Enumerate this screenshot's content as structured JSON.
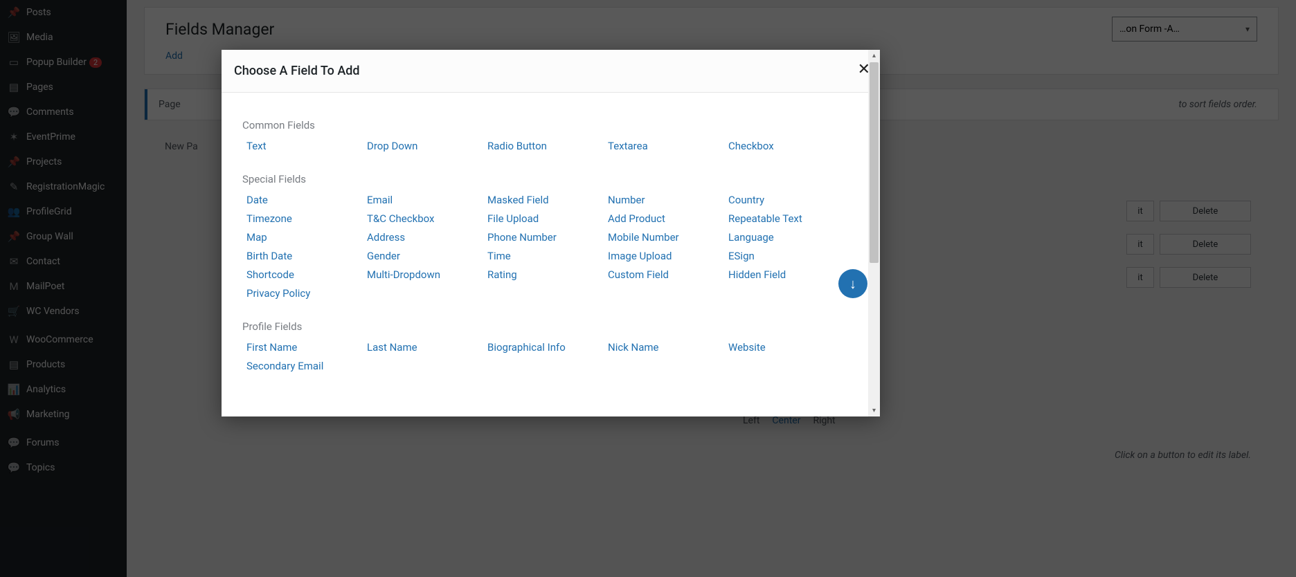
{
  "sidebar": {
    "items": [
      {
        "icon": "📌",
        "label": "Posts"
      },
      {
        "icon": "🖼",
        "label": "Media"
      },
      {
        "icon": "▭",
        "label": "Popup Builder",
        "badge": "2"
      },
      {
        "icon": "▤",
        "label": "Pages"
      },
      {
        "icon": "💬",
        "label": "Comments"
      },
      {
        "icon": "✶",
        "label": "EventPrime"
      },
      {
        "icon": "📌",
        "label": "Projects"
      },
      {
        "icon": "✎",
        "label": "RegistrationMagic"
      },
      {
        "icon": "👥",
        "label": "ProfileGrid"
      },
      {
        "icon": "📌",
        "label": "Group Wall"
      },
      {
        "icon": "✉",
        "label": "Contact"
      },
      {
        "icon": "M",
        "label": "MailPoet"
      },
      {
        "icon": "🛒",
        "label": "WC Vendors"
      },
      {
        "icon": "",
        "label": ""
      },
      {
        "icon": "W",
        "label": "WooCommerce"
      },
      {
        "icon": "▤",
        "label": "Products"
      },
      {
        "icon": "📊",
        "label": "Analytics"
      },
      {
        "icon": "📢",
        "label": "Marketing"
      },
      {
        "icon": "",
        "label": ""
      },
      {
        "icon": "💬",
        "label": "Forums"
      },
      {
        "icon": "💬",
        "label": "Topics"
      }
    ]
  },
  "header": {
    "title": "Fields Manager",
    "add_link": "Add",
    "form_selector": "…on Form -A…"
  },
  "tabs": {
    "active_label": "Page",
    "sort_hint": "to sort fields order."
  },
  "new_page_label": "New Pa",
  "row_actions": {
    "edit_partial": "it",
    "delete": "Delete"
  },
  "align": {
    "left": "Left",
    "center": "Center",
    "right": "Right"
  },
  "hint2": "Click on a button to edit its label.",
  "modal": {
    "title": "Choose A Field To Add",
    "sections": [
      {
        "title": "Common Fields",
        "fields": [
          "Text",
          "Drop Down",
          "Radio Button",
          "Textarea",
          "Checkbox"
        ]
      },
      {
        "title": "Special Fields",
        "fields": [
          "Date",
          "Email",
          "Masked Field",
          "Number",
          "Country",
          "Timezone",
          "T&C Checkbox",
          "File Upload",
          "Add Product",
          "Repeatable Text",
          "Map",
          "Address",
          "Phone Number",
          "Mobile Number",
          "Language",
          "Birth Date",
          "Gender",
          "Time",
          "Image Upload",
          "ESign",
          "Shortcode",
          "Multi-Dropdown",
          "Rating",
          "Custom Field",
          "Hidden Field",
          "Privacy Policy"
        ]
      },
      {
        "title": "Profile Fields",
        "fields": [
          "First Name",
          "Last Name",
          "Biographical Info",
          "Nick Name",
          "Website",
          "Secondary Email"
        ]
      }
    ]
  }
}
